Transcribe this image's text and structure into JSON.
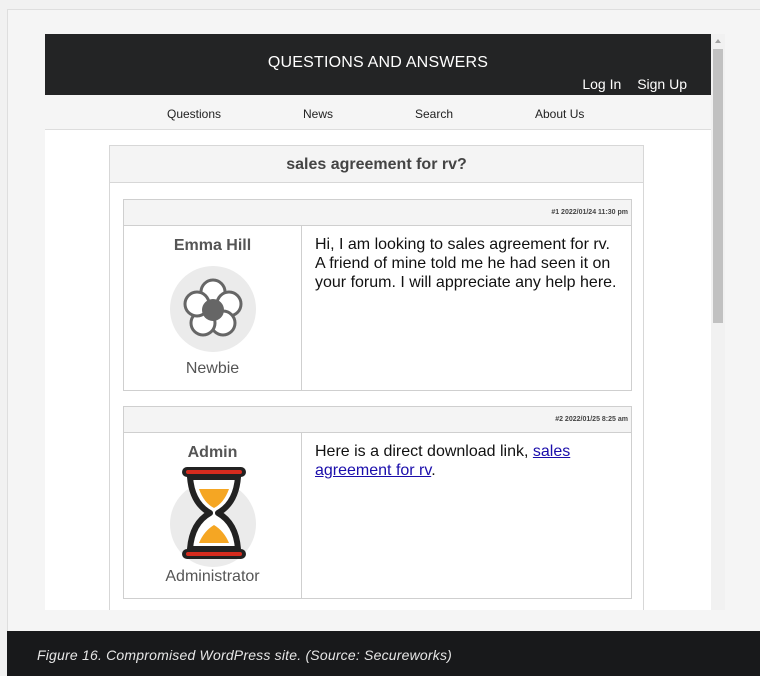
{
  "site": {
    "title": "QUESTIONS AND ANSWERS",
    "login": "Log In",
    "signup": "Sign Up"
  },
  "nav": {
    "items": [
      {
        "label": "Questions"
      },
      {
        "label": "News"
      },
      {
        "label": "Search"
      },
      {
        "label": "About Us"
      }
    ]
  },
  "thread": {
    "title": "sales agreement for rv?",
    "posts": [
      {
        "meta": "#1 2022/01/24 11:30 pm",
        "author": "Emma Hill",
        "role": "Newbie",
        "avatar_icon": "flower-icon",
        "message": "Hi, I am looking to sales agreement for rv. A friend of mine told me he had seen it on your forum. I will appreciate any help here."
      },
      {
        "meta": "#2 2022/01/25 8:25 am",
        "author": "Admin",
        "role": "Administrator",
        "avatar_icon": "hourglass-icon",
        "message_prefix": "Here is a direct download link, ",
        "link_text": "sales agreement for rv",
        "message_suffix": "."
      }
    ]
  },
  "caption": "Figure 16. Compromised WordPress site. (Source: Secureworks)",
  "colors": {
    "header_bg": "#232425",
    "link": "#1a0dab",
    "caption_bg": "#18191b",
    "hourglass_frame": "#d52b1e",
    "sand": "#f5a623"
  }
}
